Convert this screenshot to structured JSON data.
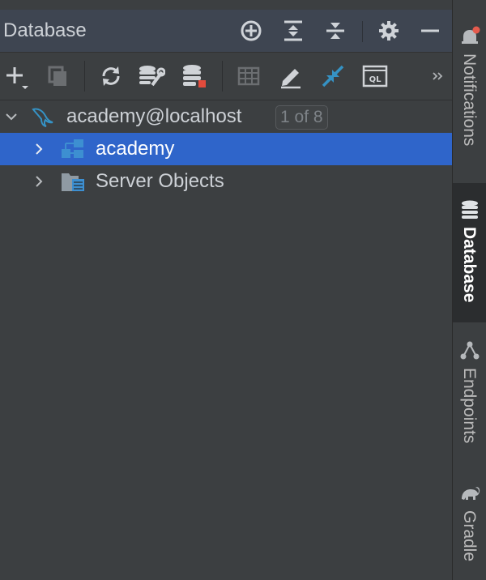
{
  "panel": {
    "title": "Database"
  },
  "header_icons": [
    "crosshair-icon",
    "expand-all-icon",
    "collapse-all-icon",
    "gear-icon",
    "minimize-icon"
  ],
  "toolbar_icons": [
    "add-icon",
    "duplicate-icon",
    "refresh-icon",
    "data-source-properties-icon",
    "stop-icon",
    "table-view-icon",
    "edit-icon",
    "jump-to-console-icon",
    "query-console-icon",
    "more-icon"
  ],
  "tree": {
    "connection": {
      "label": "academy@localhost",
      "badge": "1 of 8",
      "icon": "mysql-dolphin-icon"
    },
    "items": [
      {
        "label": "academy",
        "icon": "schema-icon",
        "selected": true
      },
      {
        "label": "Server Objects",
        "icon": "server-objects-folder-icon",
        "selected": false
      }
    ]
  },
  "side_rail": {
    "tabs": [
      {
        "label": "Notifications",
        "icon": "bell-icon",
        "active": false
      },
      {
        "label": "Database",
        "icon": "database-icon",
        "active": true
      },
      {
        "label": "Endpoints",
        "icon": "endpoints-icon",
        "active": false
      },
      {
        "label": "Gradle",
        "icon": "gradle-elephant-icon",
        "active": false
      }
    ]
  },
  "colors": {
    "background": "#3c3f41",
    "header": "#3e4551",
    "selection": "#2f65ca",
    "accent_blue": "#3592c4",
    "notification_dot": "#e55b4d"
  }
}
